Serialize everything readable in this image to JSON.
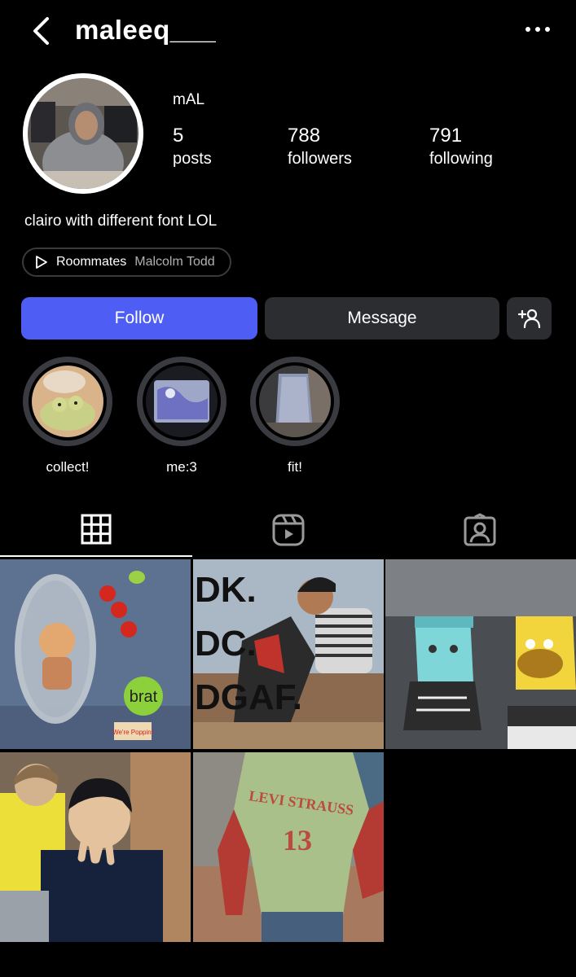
{
  "header": {
    "username": "maleeq___",
    "back_icon": "chevron-left-icon",
    "more_icon": "more-horizontal-icon"
  },
  "profile": {
    "display_name": "mAL",
    "stats": {
      "posts": {
        "count": "5",
        "label": "posts"
      },
      "followers": {
        "count": "788",
        "label": "followers"
      },
      "following": {
        "count": "791",
        "label": "following"
      }
    },
    "bio": "clairo with different font LOL",
    "music": {
      "song": "Roommates",
      "artist": "Malcolm Todd"
    }
  },
  "actions": {
    "follow_label": "Follow",
    "message_label": "Message",
    "add_person_icon": "add-person-icon"
  },
  "highlights": [
    {
      "label": "collect!"
    },
    {
      "label": "me:3"
    },
    {
      "label": "fit!"
    }
  ],
  "tabs": [
    {
      "name": "grid",
      "icon": "grid-icon",
      "active": true
    },
    {
      "name": "reels",
      "icon": "reels-icon",
      "active": false
    },
    {
      "name": "tagged",
      "icon": "tagged-icon",
      "active": false
    }
  ],
  "posts": [
    {
      "caption_text": "brat",
      "second_text": "We're Poppin!"
    },
    {
      "lines": [
        "DK.",
        "DC.",
        "DGAF."
      ]
    },
    {},
    {},
    {
      "shirt_text": "LEVI STRAUSS",
      "shirt_number": "13"
    }
  ],
  "colors": {
    "background": "#000000",
    "follow_button": "#4e5ef5",
    "secondary_button": "#2c2d31"
  }
}
